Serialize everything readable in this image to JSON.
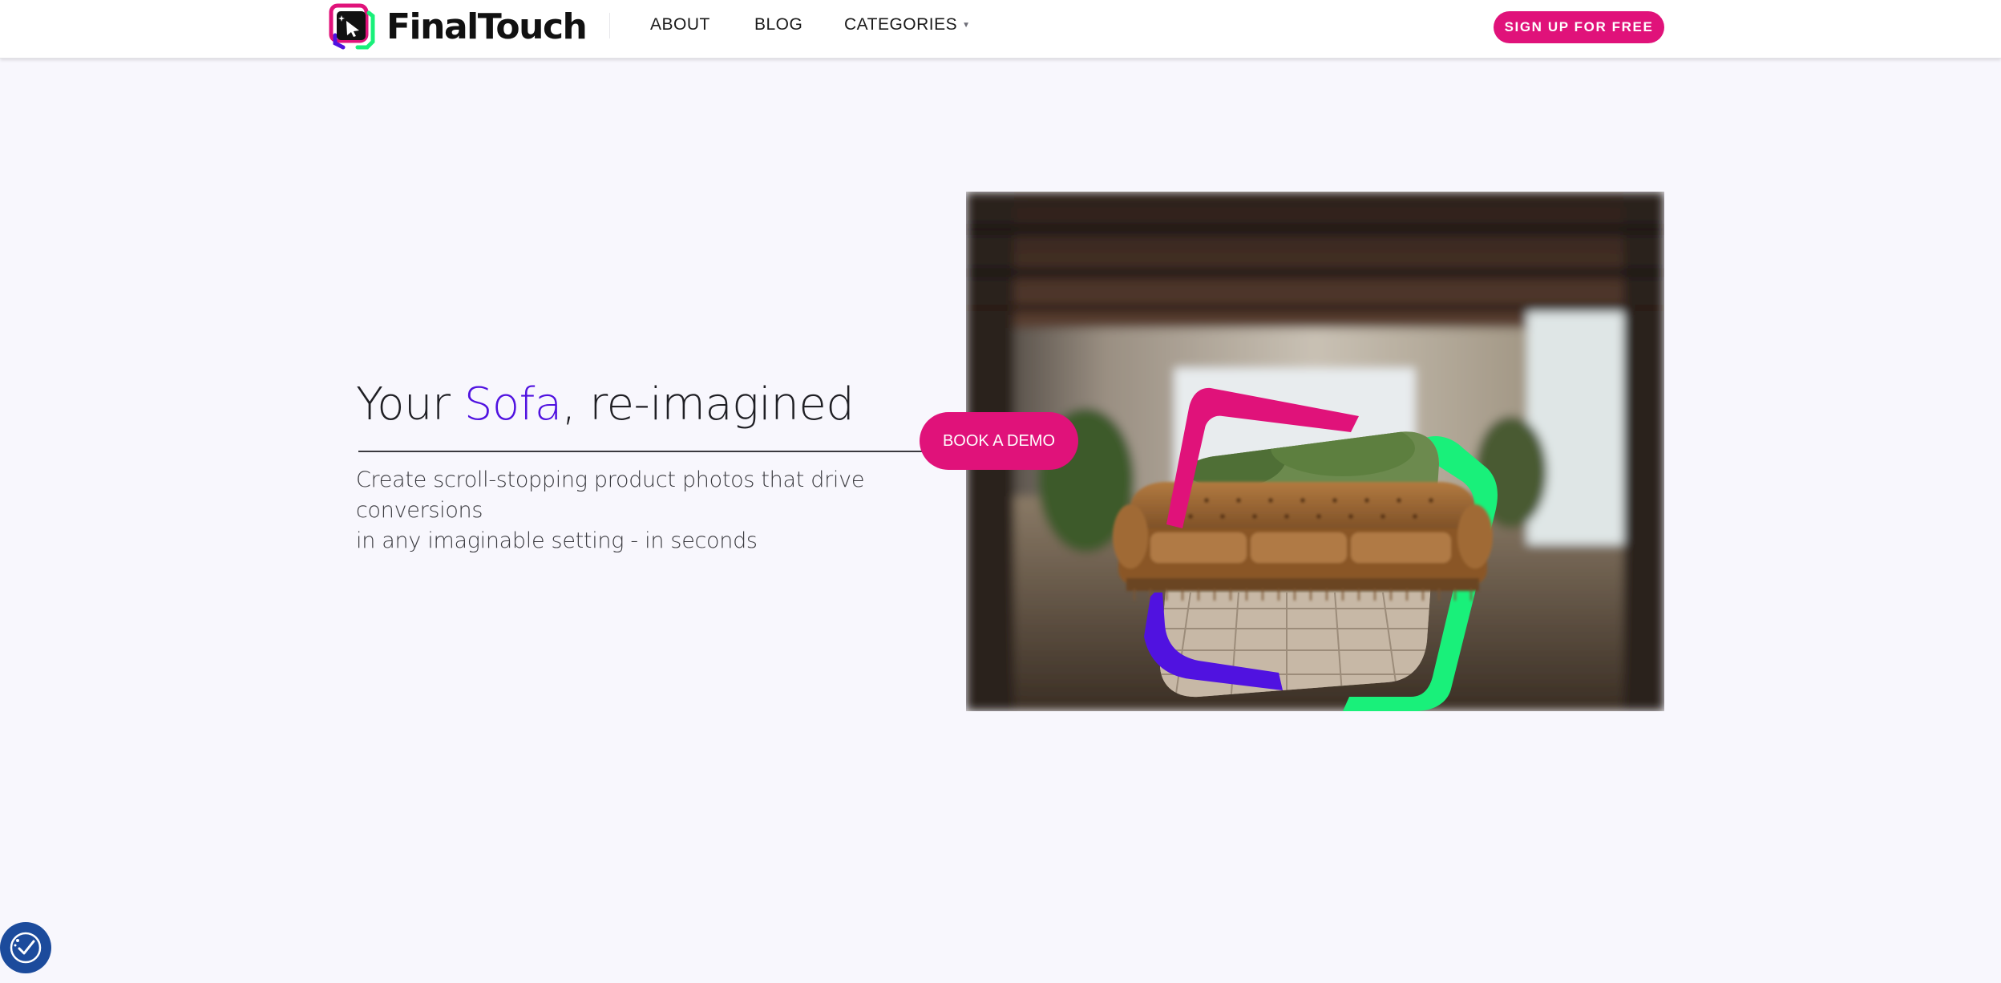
{
  "brand": {
    "name": "FinalTouch",
    "colors": {
      "pink": "#e0127a",
      "purple": "#5012e0",
      "green": "#19f07a",
      "dark": "#111111"
    }
  },
  "nav": {
    "about": "ABOUT",
    "blog": "BLOG",
    "categories": "CATEGORIES",
    "categories_icon": "chevron-down-icon"
  },
  "header": {
    "signup_label": "SIGN UP FOR FREE"
  },
  "hero": {
    "title_prefix": "Your ",
    "title_accent": "Sofa",
    "title_suffix": ", re-imagined",
    "subtitle_line1": "Create scroll-stopping product photos that drive conversions",
    "subtitle_line2": "in any imaginable setting - in seconds",
    "demo_label": "BOOK A DEMO",
    "image_subject": "sofa-in-loft-photo"
  },
  "accessibility": {
    "icon": "accessibility-icon",
    "color": "#1c4b9c"
  }
}
